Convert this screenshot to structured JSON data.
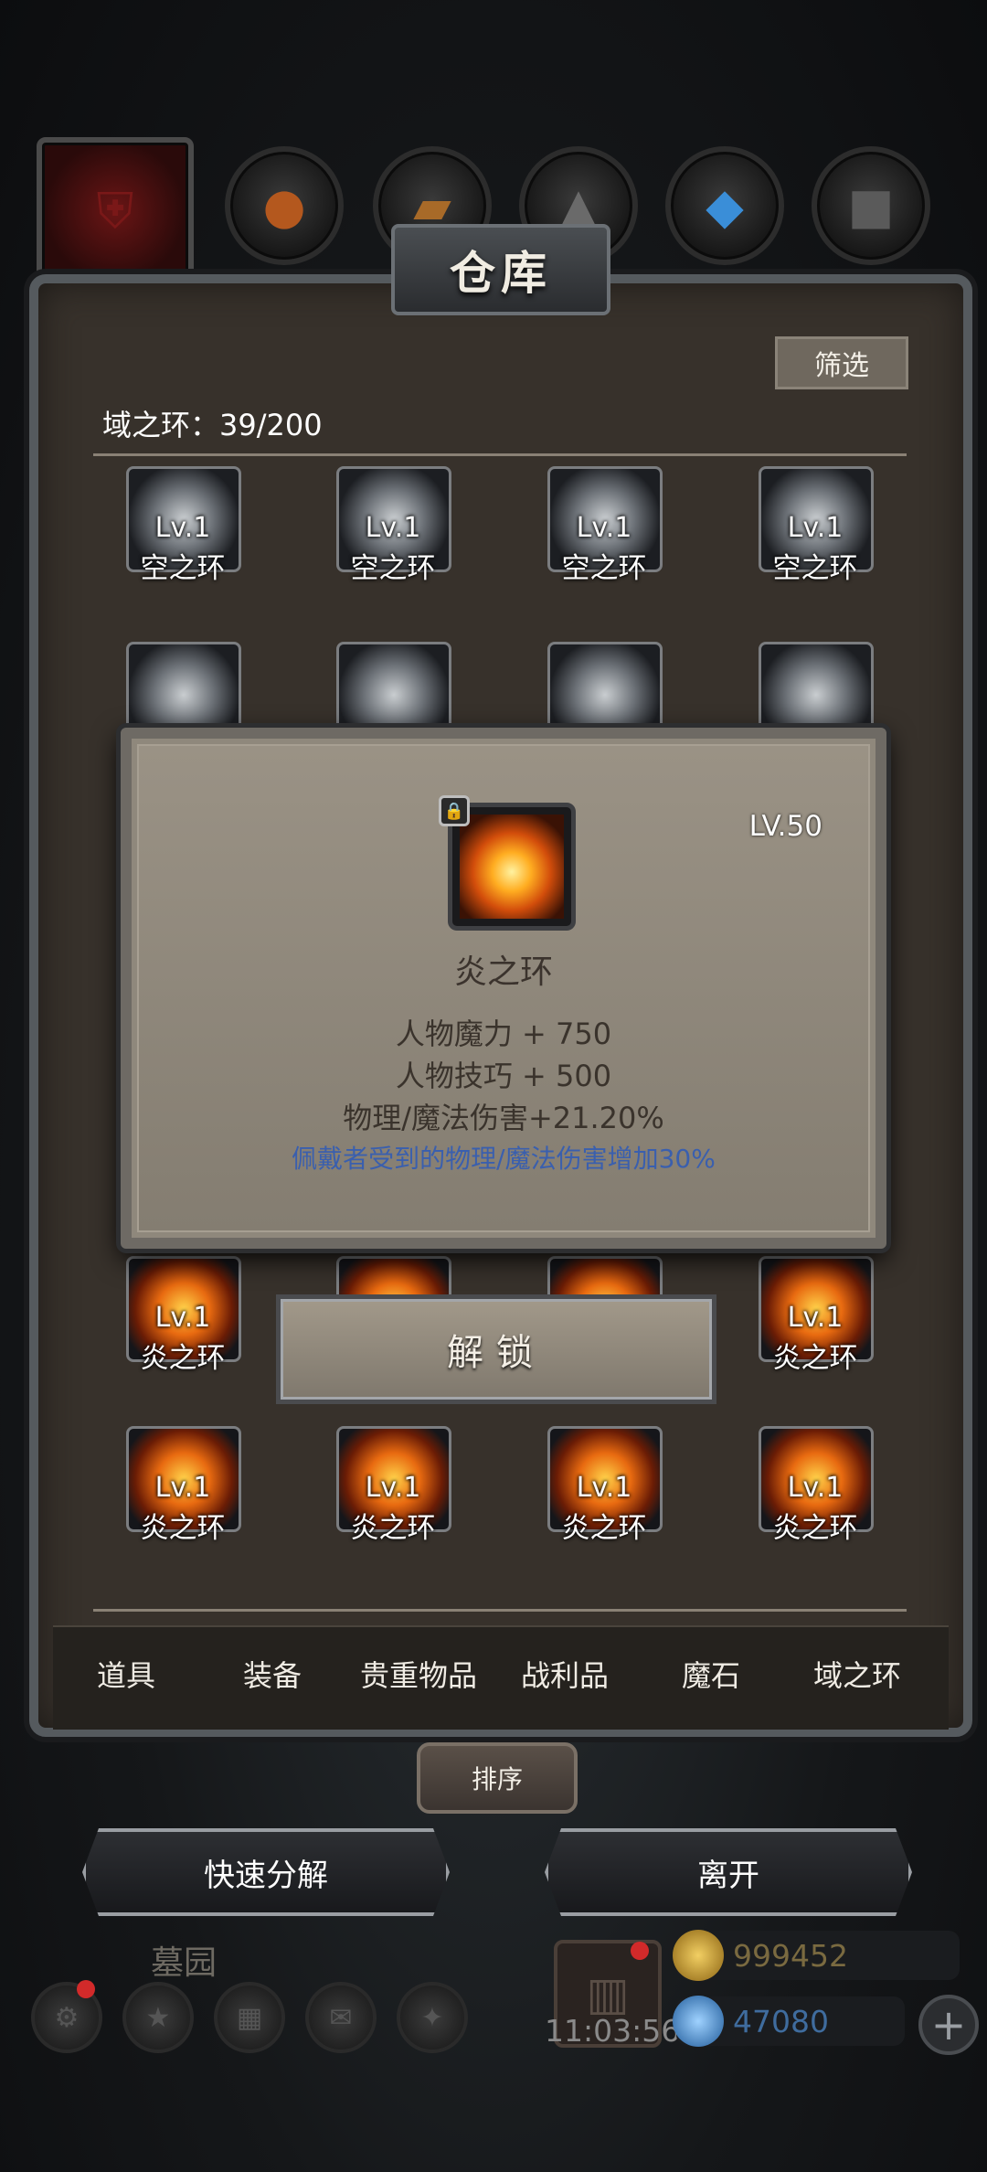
{
  "panel": {
    "title": "仓库",
    "filter_label": "筛选",
    "counter_label": "域之环：39/200"
  },
  "top_tabs": [
    {
      "icon": "helmet-icon"
    },
    {
      "icon": "cake-icon"
    },
    {
      "icon": "wood-plank-icon"
    },
    {
      "icon": "ore-icon"
    },
    {
      "icon": "crystal-icon"
    },
    {
      "icon": "metal-icon"
    }
  ],
  "grid": {
    "row1": [
      {
        "level": "Lv.1",
        "name": "空之环"
      },
      {
        "level": "Lv.1",
        "name": "空之环"
      },
      {
        "level": "Lv.1",
        "name": "空之环"
      },
      {
        "level": "Lv.1",
        "name": "空之环"
      }
    ],
    "row3": [
      {
        "level": "Lv.1",
        "name": "炎之环"
      },
      {
        "level": "Lv.1",
        "name": "炎之环"
      }
    ],
    "row4": [
      {
        "level": "Lv.1",
        "name": "炎之环"
      },
      {
        "level": "Lv.1",
        "name": "炎之环"
      },
      {
        "level": "Lv.1",
        "name": "炎之环"
      },
      {
        "level": "Lv.1",
        "name": "炎之环"
      }
    ]
  },
  "categories": [
    "道具",
    "装备",
    "贵重物品",
    "战利品",
    "魔石",
    "域之环"
  ],
  "popup": {
    "level": "LV.50",
    "item_name": "炎之环",
    "stat1": "人物魔力 + 750",
    "stat2": "人物技巧 + 500",
    "stat3": "物理/魔法伤害+21.20%",
    "special": "佩戴者受到的物理/魔法伤害增加30%",
    "unlock_label": "解锁"
  },
  "buttons": {
    "sort": "排序",
    "quick_decompose": "快速分解",
    "leave": "离开"
  },
  "hud": {
    "area": "墓园",
    "clock": "11:03:56",
    "gold": "999452",
    "gems": "47080"
  },
  "colors": {
    "gold": "#d8a83a",
    "gem": "#4a9ee8",
    "special_text": "#3a5fae"
  }
}
